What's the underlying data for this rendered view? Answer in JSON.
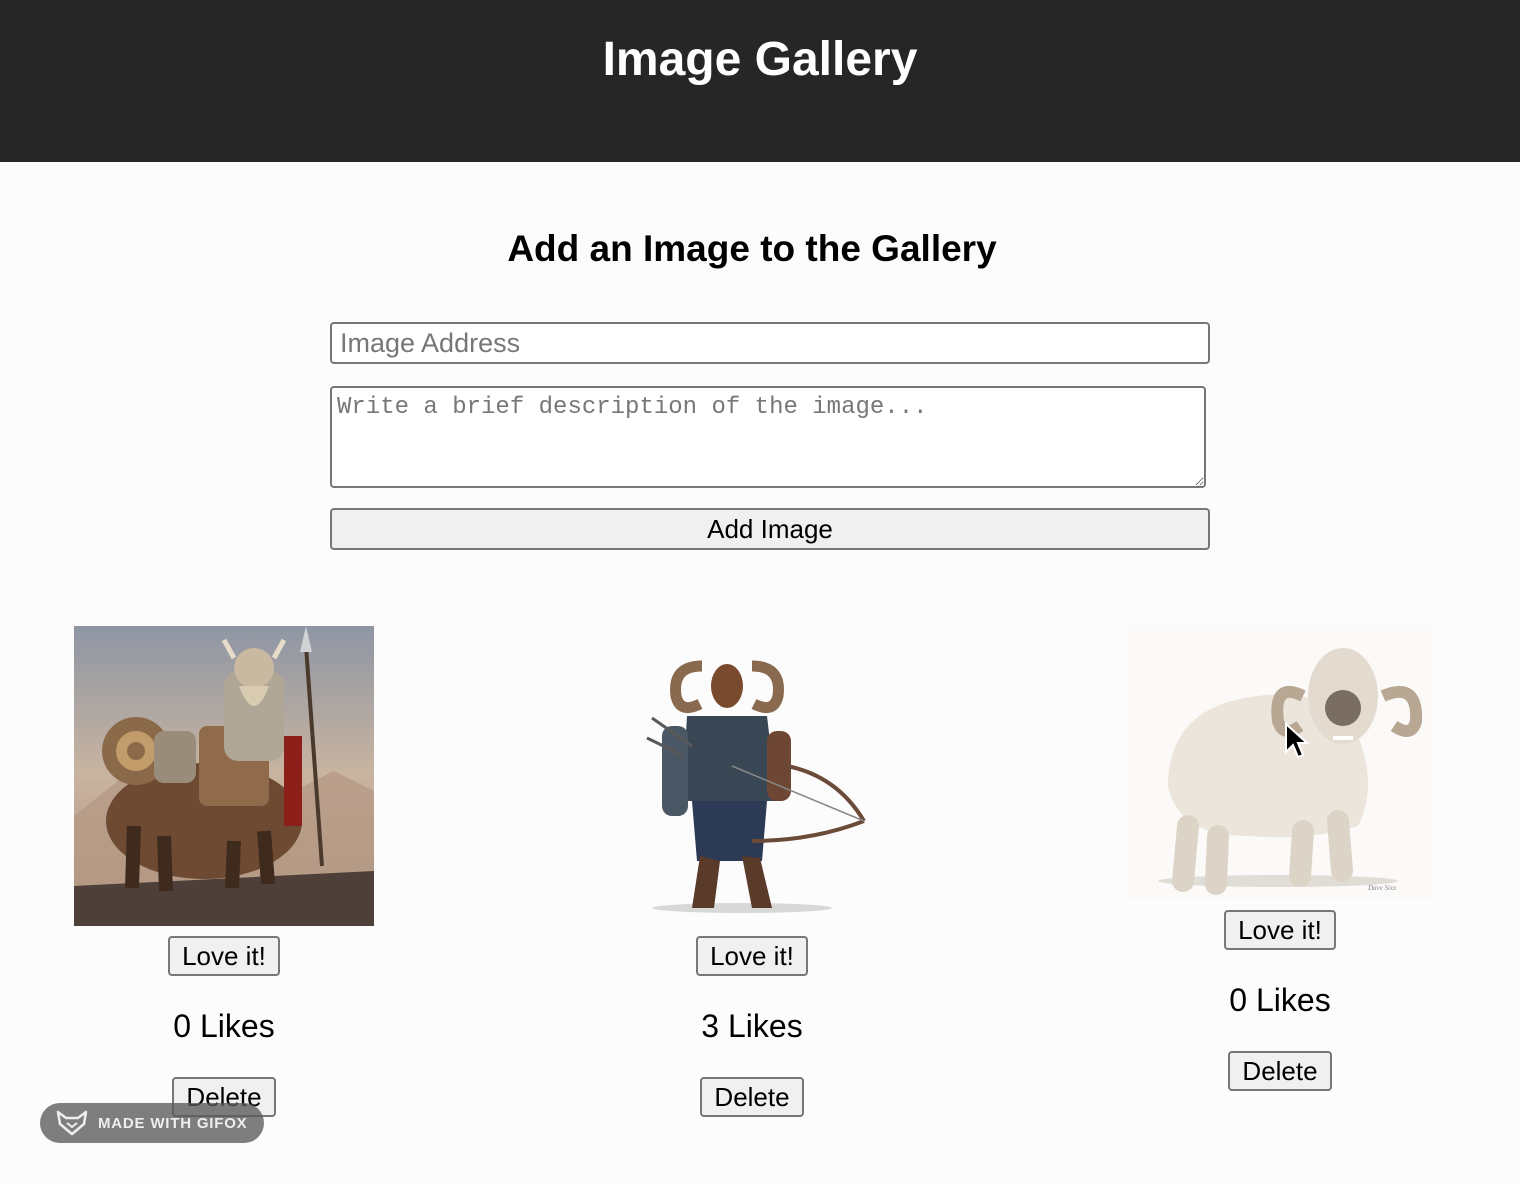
{
  "header": {
    "title": "Image Gallery",
    "bg_color": "#262626"
  },
  "form": {
    "title": "Add an Image to the Gallery",
    "url_placeholder": "Image Address",
    "description_placeholder": "Write a brief description of the image...",
    "submit_label": "Add Image"
  },
  "gallery": {
    "cards": [
      {
        "love_label": "Love it!",
        "likes_text": "0 Likes",
        "delete_label": "Delete"
      },
      {
        "love_label": "Love it!",
        "likes_text": "3 Likes",
        "delete_label": "Delete"
      },
      {
        "love_label": "Love it!",
        "likes_text": "0 Likes",
        "delete_label": "Delete"
      }
    ]
  },
  "overlay": {
    "badge_text": "MADE WITH GIFOX"
  }
}
